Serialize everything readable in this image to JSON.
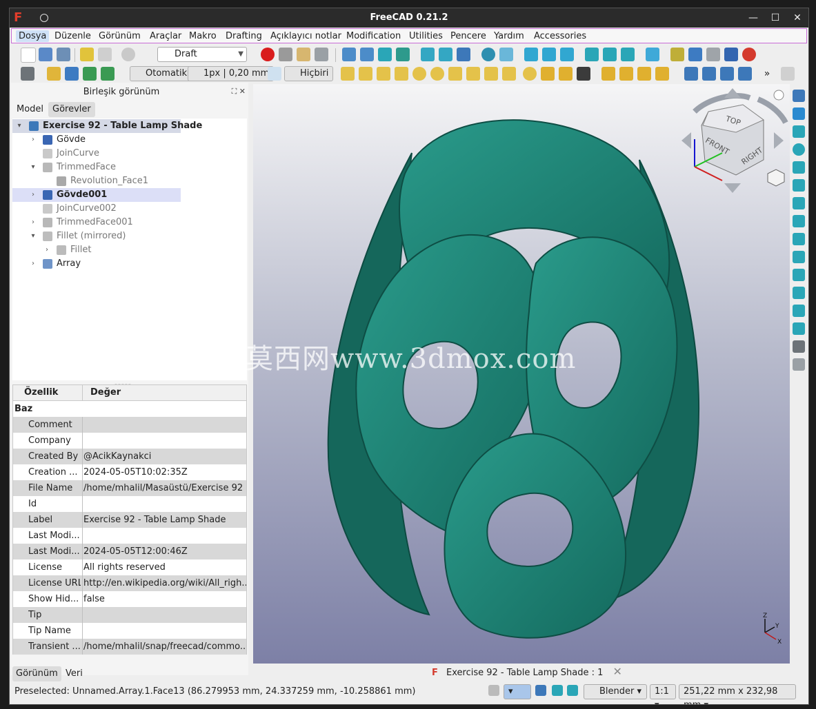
{
  "window": {
    "title": "FreeCAD 0.21.2",
    "minimize": "—",
    "maximize": "☐",
    "close": "✕"
  },
  "menu": [
    "Dosya",
    "Düzenle",
    "Görünüm",
    "Araçlar",
    "Makro",
    "Drafting",
    "Açıklayıcı notlar",
    "Modification",
    "Utilities",
    "Pencere",
    "Yardım",
    "Accessories"
  ],
  "toolbar": {
    "workbench": "Draft",
    "snap_mode": "Otomatik",
    "line_style": "1px | 0,20 mm",
    "construction": "Hiçbiri"
  },
  "panel": {
    "title": "Birleşik görünüm",
    "tabs": [
      "Model",
      "Görevler"
    ],
    "bottom_tabs": [
      "Görünüm",
      "Veri"
    ]
  },
  "tree": [
    {
      "label": "Exercise 92 - Table Lamp Shade",
      "depth": 0,
      "expander": "▾",
      "icon": "document-icon",
      "bold": true,
      "root": true
    },
    {
      "label": "Gövde",
      "depth": 1,
      "expander": "›",
      "icon": "body-icon"
    },
    {
      "label": "JoinCurve",
      "depth": 1,
      "expander": "",
      "icon": "curve-icon",
      "grey": true
    },
    {
      "label": "TrimmedFace",
      "depth": 1,
      "expander": "▾",
      "icon": "trimmed-face-icon",
      "grey": true
    },
    {
      "label": "Revolution_Face1",
      "depth": 2,
      "expander": "",
      "icon": "solid-icon",
      "grey": true
    },
    {
      "label": "Gövde001",
      "depth": 1,
      "expander": "›",
      "icon": "body-icon",
      "bold": true,
      "highlight": true
    },
    {
      "label": "JoinCurve002",
      "depth": 1,
      "expander": "",
      "icon": "curve-icon",
      "grey": true
    },
    {
      "label": "TrimmedFace001",
      "depth": 1,
      "expander": "›",
      "icon": "trimmed-face-icon",
      "grey": true
    },
    {
      "label": "Fillet (mirrored)",
      "depth": 1,
      "expander": "▾",
      "icon": "mirror-icon",
      "grey": true
    },
    {
      "label": "Fillet",
      "depth": 2,
      "expander": "›",
      "icon": "fillet-icon",
      "grey": true
    },
    {
      "label": "Array",
      "depth": 1,
      "expander": "›",
      "icon": "array-icon"
    }
  ],
  "properties": {
    "headers": [
      "Özellik",
      "Değer"
    ],
    "group": "Baz",
    "rows": [
      {
        "key": "Comment",
        "value": ""
      },
      {
        "key": "Company",
        "value": ""
      },
      {
        "key": "Created By",
        "value": "@AcikKaynakci"
      },
      {
        "key": "Creation ...",
        "value": "2024-05-05T10:02:35Z"
      },
      {
        "key": "File Name",
        "value": "/home/mhalil/Masaüstü/Exercise 92 ..."
      },
      {
        "key": "Id",
        "value": ""
      },
      {
        "key": "Label",
        "value": "Exercise 92 - Table Lamp Shade"
      },
      {
        "key": "Last Modi...",
        "value": ""
      },
      {
        "key": "Last Modi...",
        "value": "2024-05-05T12:00:46Z"
      },
      {
        "key": "License",
        "value": "All rights reserved"
      },
      {
        "key": "License URL",
        "value": "http://en.wikipedia.org/wiki/All_righ..."
      },
      {
        "key": "Show Hid...",
        "value": "false"
      },
      {
        "key": "Tip",
        "value": ""
      },
      {
        "key": "Tip Name",
        "value": ""
      },
      {
        "key": "Transient ...",
        "value": "/home/mhalil/snap/freecad/commo..."
      }
    ]
  },
  "navcube": {
    "top": "TOP",
    "front": "FRONT",
    "right": "RIGHT"
  },
  "axes": {
    "x": "X",
    "y": "Y",
    "z": "Z"
  },
  "watermark": "莫西网www.3dmox.com",
  "doc_tab": "Exercise 92 - Table Lamp Shade : 1",
  "status": {
    "message": "Preselected: Unnamed.Array.1.Face13 (86.279953 mm, 24.337259 mm, -10.258861 mm)",
    "nav_style": "Blender",
    "zoom": "1:1",
    "dimensions": "251,22 mm x 232,98 mm"
  },
  "colors": {
    "model": "#1f8577",
    "model_dark": "#0f4b43",
    "accent": "#c86bd6"
  }
}
